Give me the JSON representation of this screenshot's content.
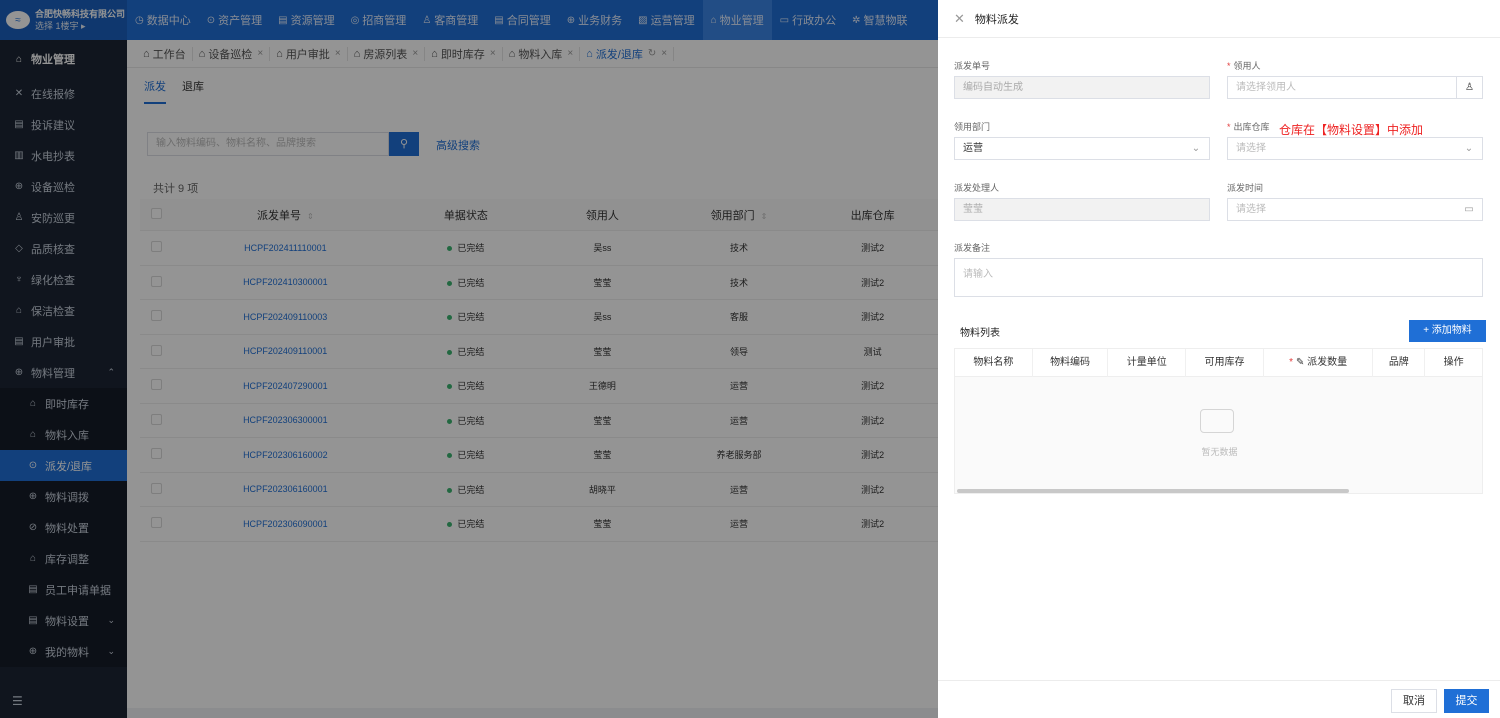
{
  "brand": {
    "company": "合肥快畅科技有限公司",
    "building": "选择 1楼宇 ▸"
  },
  "topnav": [
    {
      "label": "数据中心",
      "icon": "dashboard-icon",
      "glyph": "◷"
    },
    {
      "label": "资产管理",
      "icon": "cube-icon",
      "glyph": "⊙"
    },
    {
      "label": "资源管理",
      "icon": "document-icon",
      "glyph": "▤"
    },
    {
      "label": "招商管理",
      "icon": "target-icon",
      "glyph": "◎"
    },
    {
      "label": "客商管理",
      "icon": "users-icon",
      "glyph": "♙"
    },
    {
      "label": "合同管理",
      "icon": "contract-icon",
      "glyph": "▤"
    },
    {
      "label": "业务财务",
      "icon": "finance-icon",
      "glyph": "⊕"
    },
    {
      "label": "运营管理",
      "icon": "chart-icon",
      "glyph": "▨"
    },
    {
      "label": "物业管理",
      "icon": "home-icon",
      "glyph": "⌂"
    },
    {
      "label": "行政办公",
      "icon": "office-icon",
      "glyph": "▭"
    },
    {
      "label": "智慧物联",
      "icon": "iot-icon",
      "glyph": "✲"
    }
  ],
  "sidebar": {
    "header": "物业管理",
    "items": [
      {
        "label": "在线报修",
        "icon": "wrench-icon",
        "glyph": "✕"
      },
      {
        "label": "投诉建议",
        "icon": "complaint-icon",
        "glyph": "▤"
      },
      {
        "label": "水电抄表",
        "icon": "meter-icon",
        "glyph": "▥"
      },
      {
        "label": "设备巡检",
        "icon": "device-icon",
        "glyph": "⊕"
      },
      {
        "label": "安防巡更",
        "icon": "security-icon",
        "glyph": "♙"
      },
      {
        "label": "品质核查",
        "icon": "quality-icon",
        "glyph": "◇"
      },
      {
        "label": "绿化检查",
        "icon": "plant-icon",
        "glyph": "♆"
      },
      {
        "label": "保洁检查",
        "icon": "clean-icon",
        "glyph": "⌂"
      },
      {
        "label": "用户审批",
        "icon": "approval-icon",
        "glyph": "▤"
      }
    ],
    "group": "物料管理",
    "subitems": [
      {
        "label": "即时库存",
        "icon": "stock-icon",
        "glyph": "⌂"
      },
      {
        "label": "物料入库",
        "icon": "inbound-icon",
        "glyph": "⌂"
      },
      {
        "label": "派发/退库",
        "icon": "dispatch-icon",
        "glyph": "⊙"
      },
      {
        "label": "物料调拨",
        "icon": "transfer-icon",
        "glyph": "⊕"
      },
      {
        "label": "物料处置",
        "icon": "dispose-icon",
        "glyph": "⊘"
      },
      {
        "label": "库存调整",
        "icon": "adjust-icon",
        "glyph": "⌂"
      },
      {
        "label": "员工申请单据",
        "icon": "form-icon",
        "glyph": "▤"
      },
      {
        "label": "物料设置",
        "icon": "settings-icon",
        "glyph": "▤"
      },
      {
        "label": "我的物料",
        "icon": "my-material-icon",
        "glyph": "⊕"
      }
    ]
  },
  "tabs": [
    {
      "label": "工作台",
      "icon": "workbench-icon",
      "closable": false
    },
    {
      "label": "设备巡检",
      "icon": "device-icon",
      "closable": true
    },
    {
      "label": "用户审批",
      "icon": "approval-icon",
      "closable": true
    },
    {
      "label": "房源列表",
      "icon": "house-icon",
      "closable": true
    },
    {
      "label": "即时库存",
      "icon": "stock-icon",
      "closable": true
    },
    {
      "label": "物料入库",
      "icon": "inbound-icon",
      "closable": true
    },
    {
      "label": "派发/退库",
      "icon": "dispatch-icon",
      "closable": true
    }
  ],
  "main": {
    "subtabs": [
      "派发",
      "退库"
    ],
    "search_placeholder": "输入物料编码、物料名称、品牌搜索",
    "advanced_search": "高级搜索",
    "total": "共计 9 项",
    "columns": [
      "派发单号",
      "单据状态",
      "领用人",
      "领用部门",
      "出库仓库"
    ],
    "rows": [
      {
        "no": "HCPF202411110001",
        "status": "已完结",
        "user": "吴ss",
        "dept": "技术",
        "warehouse": "测试2"
      },
      {
        "no": "HCPF202410300001",
        "status": "已完结",
        "user": "莹莹",
        "dept": "技术",
        "warehouse": "测试2"
      },
      {
        "no": "HCPF202409110003",
        "status": "已完结",
        "user": "吴ss",
        "dept": "客服",
        "warehouse": "测试2"
      },
      {
        "no": "HCPF202409110001",
        "status": "已完结",
        "user": "莹莹",
        "dept": "领导",
        "warehouse": "测试"
      },
      {
        "no": "HCPF202407290001",
        "status": "已完结",
        "user": "王德明",
        "dept": "运营",
        "warehouse": "测试2"
      },
      {
        "no": "HCPF202306300001",
        "status": "已完结",
        "user": "莹莹",
        "dept": "运营",
        "warehouse": "测试2"
      },
      {
        "no": "HCPF202306160002",
        "status": "已完结",
        "user": "莹莹",
        "dept": "养老服务部",
        "warehouse": "测试2"
      },
      {
        "no": "HCPF202306160001",
        "status": "已完结",
        "user": "胡晓平",
        "dept": "运营",
        "warehouse": "测试2"
      },
      {
        "no": "HCPF202306090001",
        "status": "已完结",
        "user": "莹莹",
        "dept": "运营",
        "warehouse": "测试2"
      }
    ]
  },
  "drawer": {
    "title": "物料派发",
    "fields": {
      "order_no_label": "派发单号",
      "order_no_value": "编码自动生成",
      "receiver_label": "领用人",
      "receiver_placeholder": "请选择领用人",
      "dept_label": "领用部门",
      "dept_value": "运营",
      "warehouse_label": "出库仓库",
      "warehouse_placeholder": "请选择",
      "warehouse_note": "仓库在【物料设置】中添加",
      "handler_label": "派发处理人",
      "handler_value": "莹莹",
      "time_label": "派发时间",
      "time_placeholder": "请选择",
      "remark_label": "派发备注",
      "remark_placeholder": "请输入"
    },
    "material_list_title": "物料列表",
    "add_button": "+ 添加物料",
    "material_columns": [
      "物料名称",
      "物料编码",
      "计量单位",
      "可用库存",
      "派发数量",
      "品牌",
      "操作"
    ],
    "empty_text": "暂无数据",
    "cancel": "取消",
    "submit": "提交"
  },
  "colors": {
    "primary": "#1f6fd6",
    "sidebar": "#1c2535",
    "required": "#e23c3c",
    "note": "#ee2222"
  }
}
